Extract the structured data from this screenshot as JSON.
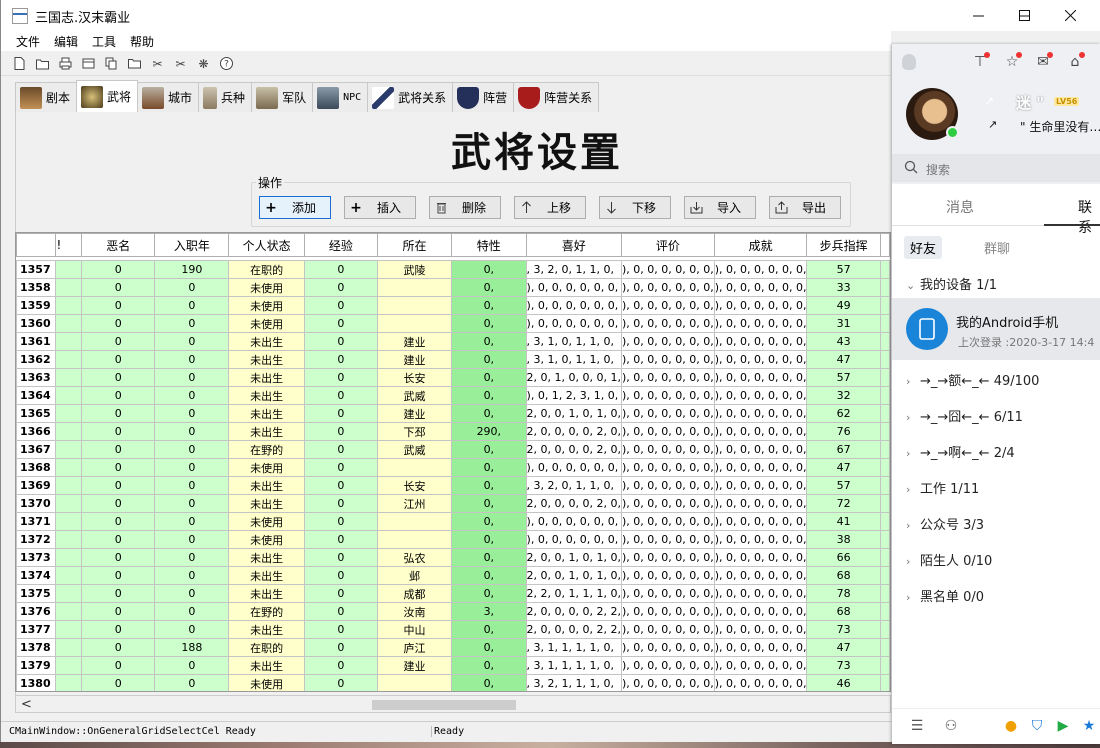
{
  "window": {
    "title": "三国志.汉末霸业"
  },
  "menu": [
    "文件",
    "编辑",
    "工具",
    "帮助"
  ],
  "toolbar_icons": [
    "new-file-icon",
    "open-folder-icon",
    "print-icon",
    "archive-icon",
    "copy-icon",
    "folder-icon",
    "cut-icon",
    "delete-icon",
    "settings-icon",
    "help-icon"
  ],
  "tabs": [
    {
      "label": "剧本"
    },
    {
      "label": "武将"
    },
    {
      "label": "城市"
    },
    {
      "label": "兵种"
    },
    {
      "label": "军队"
    },
    {
      "label": "NPC"
    },
    {
      "label": "武将关系"
    },
    {
      "label": "阵营"
    },
    {
      "label": "阵营关系"
    }
  ],
  "page_title": "武将设置",
  "operations": {
    "group_label": "操作",
    "buttons": [
      {
        "label": "添加",
        "icon": "plus-icon"
      },
      {
        "label": "插入",
        "icon": "plus-icon"
      },
      {
        "label": "删除",
        "icon": "trash-icon"
      },
      {
        "label": "上移",
        "icon": "arrow-up-icon"
      },
      {
        "label": "下移",
        "icon": "arrow-down-icon"
      },
      {
        "label": "导入",
        "icon": "import-icon"
      },
      {
        "label": "导出",
        "icon": "export-icon"
      }
    ]
  },
  "grid": {
    "columns": [
      "!",
      "恶名",
      "入职年",
      "个人状态",
      "经验",
      "所在",
      "特性",
      "喜好",
      "评价",
      "成就",
      "步兵指挥"
    ],
    "rows": [
      {
        "id": "1357",
        "c2": "0",
        "c3": "190",
        "c4": "在职的",
        "c5": "0",
        "c6": "武陵",
        "c7": "0,",
        "c8": ", 3, 2, 0, 1, 1, 0,",
        "c9": "), 0, 0, 0, 0, 0, 0,",
        "c10": "), 0, 0, 0, 0, 0, 0,",
        "c11": "57"
      },
      {
        "id": "1358",
        "c2": "0",
        "c3": "0",
        "c4": "未使用",
        "c5": "0",
        "c6": "",
        "c7": "0,",
        "c8": "), 0, 0, 0, 0, 0, 0,",
        "c9": "), 0, 0, 0, 0, 0, 0,",
        "c10": "), 0, 0, 0, 0, 0, 0,",
        "c11": "33"
      },
      {
        "id": "1359",
        "c2": "0",
        "c3": "0",
        "c4": "未使用",
        "c5": "0",
        "c6": "",
        "c7": "0,",
        "c8": "), 0, 0, 0, 0, 0, 0,",
        "c9": "), 0, 0, 0, 0, 0, 0,",
        "c10": "), 0, 0, 0, 0, 0, 0,",
        "c11": "49"
      },
      {
        "id": "1360",
        "c2": "0",
        "c3": "0",
        "c4": "未使用",
        "c5": "0",
        "c6": "",
        "c7": "0,",
        "c8": "), 0, 0, 0, 0, 0, 0,",
        "c9": "), 0, 0, 0, 0, 0, 0,",
        "c10": "), 0, 0, 0, 0, 0, 0,",
        "c11": "31"
      },
      {
        "id": "1361",
        "c2": "0",
        "c3": "0",
        "c4": "未出生",
        "c5": "0",
        "c6": "建业",
        "c7": "0,",
        "c8": ", 3, 1, 0, 1, 1, 0,",
        "c9": "), 0, 0, 0, 0, 0, 0,",
        "c10": "), 0, 0, 0, 0, 0, 0,",
        "c11": "43"
      },
      {
        "id": "1362",
        "c2": "0",
        "c3": "0",
        "c4": "未出生",
        "c5": "0",
        "c6": "建业",
        "c7": "0,",
        "c8": ", 3, 1, 0, 1, 1, 0,",
        "c9": "), 0, 0, 0, 0, 0, 0,",
        "c10": "), 0, 0, 0, 0, 0, 0,",
        "c11": "47"
      },
      {
        "id": "1363",
        "c2": "0",
        "c3": "0",
        "c4": "未出生",
        "c5": "0",
        "c6": "长安",
        "c7": "0,",
        "c8": "2, 0, 1, 0, 0, 0, 1,",
        "c9": "), 0, 0, 0, 0, 0, 0,",
        "c10": "), 0, 0, 0, 0, 0, 0,",
        "c11": "57"
      },
      {
        "id": "1364",
        "c2": "0",
        "c3": "0",
        "c4": "未出生",
        "c5": "0",
        "c6": "武威",
        "c7": "0,",
        "c8": "), 0, 1, 2, 3, 1, 0,",
        "c9": "), 0, 0, 0, 0, 0, 0,",
        "c10": "), 0, 0, 0, 0, 0, 0,",
        "c11": "32"
      },
      {
        "id": "1365",
        "c2": "0",
        "c3": "0",
        "c4": "未出生",
        "c5": "0",
        "c6": "建业",
        "c7": "0,",
        "c8": "2, 0, 0, 1, 0, 1, 0,",
        "c9": "), 0, 0, 0, 0, 0, 0,",
        "c10": "), 0, 0, 0, 0, 0, 0,",
        "c11": "62"
      },
      {
        "id": "1366",
        "c2": "0",
        "c3": "0",
        "c4": "未出生",
        "c5": "0",
        "c6": "下邳",
        "c7": "290,",
        "c8": "2, 0, 0, 0, 0, 2, 0,",
        "c9": "), 0, 0, 0, 0, 0, 0,",
        "c10": "), 0, 0, 0, 0, 0, 0,",
        "c11": "76"
      },
      {
        "id": "1367",
        "c2": "0",
        "c3": "0",
        "c4": "在野的",
        "c5": "0",
        "c6": "武威",
        "c7": "0,",
        "c8": "2, 0, 0, 0, 0, 2, 0,",
        "c9": "), 0, 0, 0, 0, 0, 0,",
        "c10": "), 0, 0, 0, 0, 0, 0,",
        "c11": "67"
      },
      {
        "id": "1368",
        "c2": "0",
        "c3": "0",
        "c4": "未使用",
        "c5": "0",
        "c6": "",
        "c7": "0,",
        "c8": "), 0, 0, 0, 0, 0, 0,",
        "c9": "), 0, 0, 0, 0, 0, 0,",
        "c10": "), 0, 0, 0, 0, 0, 0,",
        "c11": "47"
      },
      {
        "id": "1369",
        "c2": "0",
        "c3": "0",
        "c4": "未出生",
        "c5": "0",
        "c6": "长安",
        "c7": "0,",
        "c8": ", 3, 2, 0, 1, 1, 0,",
        "c9": "), 0, 0, 0, 0, 0, 0,",
        "c10": "), 0, 0, 0, 0, 0, 0,",
        "c11": "57"
      },
      {
        "id": "1370",
        "c2": "0",
        "c3": "0",
        "c4": "未出生",
        "c5": "0",
        "c6": "江州",
        "c7": "0,",
        "c8": "2, 0, 0, 0, 0, 2, 0,",
        "c9": "), 0, 0, 0, 0, 0, 0,",
        "c10": "), 0, 0, 0, 0, 0, 0,",
        "c11": "72"
      },
      {
        "id": "1371",
        "c2": "0",
        "c3": "0",
        "c4": "未使用",
        "c5": "0",
        "c6": "",
        "c7": "0,",
        "c8": "), 0, 0, 0, 0, 0, 0,",
        "c9": "), 0, 0, 0, 0, 0, 0,",
        "c10": "), 0, 0, 0, 0, 0, 0,",
        "c11": "41"
      },
      {
        "id": "1372",
        "c2": "0",
        "c3": "0",
        "c4": "未使用",
        "c5": "0",
        "c6": "",
        "c7": "0,",
        "c8": "), 0, 0, 0, 0, 0, 0,",
        "c9": "), 0, 0, 0, 0, 0, 0,",
        "c10": "), 0, 0, 0, 0, 0, 0,",
        "c11": "38"
      },
      {
        "id": "1373",
        "c2": "0",
        "c3": "0",
        "c4": "未出生",
        "c5": "0",
        "c6": "弘农",
        "c7": "0,",
        "c8": "2, 0, 0, 1, 0, 1, 0,",
        "c9": "), 0, 0, 0, 0, 0, 0,",
        "c10": "), 0, 0, 0, 0, 0, 0,",
        "c11": "66"
      },
      {
        "id": "1374",
        "c2": "0",
        "c3": "0",
        "c4": "未出生",
        "c5": "0",
        "c6": "邺",
        "c7": "0,",
        "c8": "2, 0, 0, 1, 0, 1, 0,",
        "c9": "), 0, 0, 0, 0, 0, 0,",
        "c10": "), 0, 0, 0, 0, 0, 0,",
        "c11": "68"
      },
      {
        "id": "1375",
        "c2": "0",
        "c3": "0",
        "c4": "未出生",
        "c5": "0",
        "c6": "成都",
        "c7": "0,",
        "c8": "2, 2, 0, 1, 1, 1, 0,",
        "c9": "), 0, 0, 0, 0, 0, 0,",
        "c10": "), 0, 0, 0, 0, 0, 0,",
        "c11": "78"
      },
      {
        "id": "1376",
        "c2": "0",
        "c3": "0",
        "c4": "在野的",
        "c5": "0",
        "c6": "汝南",
        "c7": "3,",
        "c8": "2, 0, 0, 0, 0, 2, 2,",
        "c9": "), 0, 0, 0, 0, 0, 0,",
        "c10": "), 0, 0, 0, 0, 0, 0,",
        "c11": "68"
      },
      {
        "id": "1377",
        "c2": "0",
        "c3": "0",
        "c4": "未出生",
        "c5": "0",
        "c6": "中山",
        "c7": "0,",
        "c8": "2, 0, 0, 0, 0, 2, 2,",
        "c9": "), 0, 0, 0, 0, 0, 0,",
        "c10": "), 0, 0, 0, 0, 0, 0,",
        "c11": "73"
      },
      {
        "id": "1378",
        "c2": "0",
        "c3": "188",
        "c4": "在职的",
        "c5": "0",
        "c6": "庐江",
        "c7": "0,",
        "c8": ", 3, 1, 1, 1, 1, 0,",
        "c9": "), 0, 0, 0, 0, 0, 0,",
        "c10": "), 0, 0, 0, 0, 0, 0,",
        "c11": "47"
      },
      {
        "id": "1379",
        "c2": "0",
        "c3": "0",
        "c4": "未出生",
        "c5": "0",
        "c6": "建业",
        "c7": "0,",
        "c8": ", 3, 1, 1, 1, 1, 0,",
        "c9": "), 0, 0, 0, 0, 0, 0,",
        "c10": "), 0, 0, 0, 0, 0, 0,",
        "c11": "73"
      },
      {
        "id": "1380",
        "c2": "0",
        "c3": "0",
        "c4": "未使用",
        "c5": "0",
        "c6": "",
        "c7": "0,",
        "c8": ", 3, 2, 1, 1, 1, 0,",
        "c9": "), 0, 0, 0, 0, 0, 0,",
        "c10": "), 0, 0, 0, 0, 0, 0,",
        "c11": "46"
      }
    ]
  },
  "status": {
    "left": "CMainWindow::OnGeneralGridSelectCel Ready",
    "right": "Ready"
  },
  "qq": {
    "nickname": "迷 \"",
    "level_badge": "LV56",
    "signature": "\" 生命里没有…",
    "search_placeholder": "搜索",
    "tabs": [
      "消息",
      "联系"
    ],
    "sub_tabs": [
      "好友",
      "群聊"
    ],
    "device_group": "我的设备 1/1",
    "device_name": "我的Android手机",
    "device_login": "上次登录 :2020-3-17 14:4",
    "groups": [
      "→_→额←_← 49/100",
      "→_→囧←_← 6/11",
      "→_→啊←_← 2/4",
      "工作 1/11",
      "公众号 3/3",
      "陌生人 0/10",
      "黑名单 0/0"
    ]
  },
  "colors": {
    "grid_green": "#ccffcc",
    "grid_yellow": "#ffffcc",
    "grid_bright_green": "#99ee99",
    "online": "#2ecc40",
    "device_blue": "#1a84d8"
  }
}
